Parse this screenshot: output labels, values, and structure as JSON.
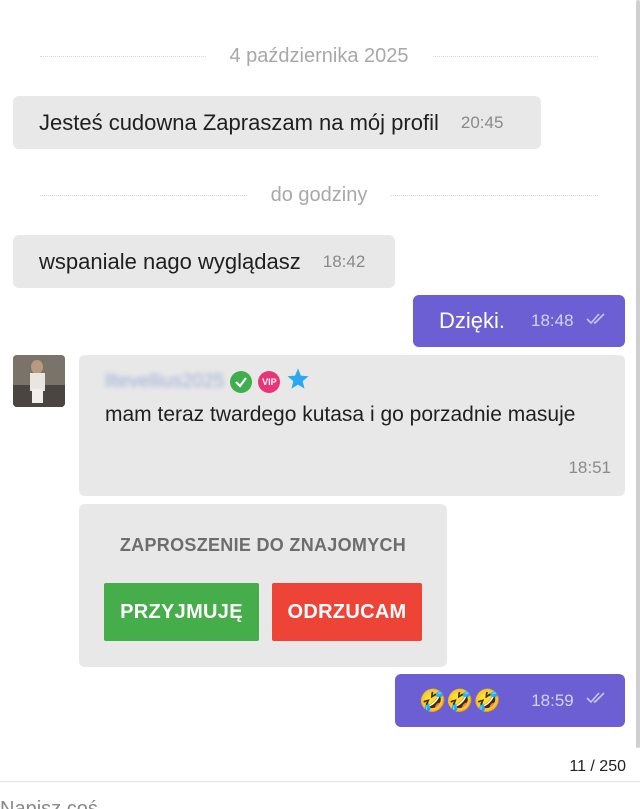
{
  "separators": {
    "date": "4 października 2025",
    "time_group": "do godziny"
  },
  "messages": [
    {
      "text": "Jesteś cudowna Zapraszam na mój profil",
      "time": "20:45"
    },
    {
      "text": "wspaniale nago wyglądasz",
      "time": "18:42"
    },
    {
      "text": "Dzięki.",
      "time": "18:48"
    },
    {
      "sender": "lltevellius2025",
      "text": "mam teraz twardego kutasa i go porzadnie masuje",
      "time": "18:51"
    },
    {
      "text": "🤣🤣🤣",
      "time": "18:59"
    }
  ],
  "badges": {
    "vip": "VIP"
  },
  "invite": {
    "title": "ZAPROSZENIE DO ZNAJOMYCH",
    "accept_label": "PRZYJMUJĘ",
    "reject_label": "ODRZUCAM"
  },
  "composer": {
    "char_counter": "11 / 250",
    "placeholder": "Napisz coś"
  },
  "colors": {
    "outgoing_bubble": "#6b5fd3",
    "incoming_bubble": "#e8e8e8",
    "accept": "#45ad4a",
    "reject": "#ee4438"
  }
}
